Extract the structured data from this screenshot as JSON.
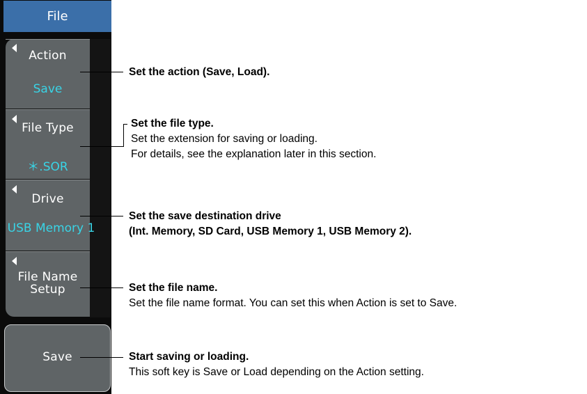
{
  "menu": {
    "title": "File",
    "softkeys": [
      {
        "label": "Action",
        "value": "Save"
      },
      {
        "label": "File Type",
        "value": "＊.SOR"
      },
      {
        "label": "Drive",
        "value": "USB Memory 1"
      },
      {
        "label_line1": "File Name",
        "label_line2": "Setup"
      }
    ],
    "execute_label": "Save"
  },
  "callouts": {
    "action": {
      "title": "Set the action (Save, Load)."
    },
    "file_type": {
      "title": "Set the file type.",
      "line1": "Set the extension for saving or loading.",
      "line2": "For details, see the explanation later in this section."
    },
    "drive": {
      "title_line1": "Set the save destination drive",
      "title_line2": "(Int. Memory, SD Card, USB Memory 1, USB Memory 2)."
    },
    "file_name": {
      "title": "Set the file name.",
      "line1": "Set the file name format. You can set this when Action is set to Save."
    },
    "save": {
      "title": "Start saving or loading.",
      "line1": "This soft key is Save or Load depending on the Action setting."
    }
  },
  "colors": {
    "header_bg": "#3b6fa9",
    "value_text": "#39d4e6",
    "key_bg": "#5f6466"
  }
}
